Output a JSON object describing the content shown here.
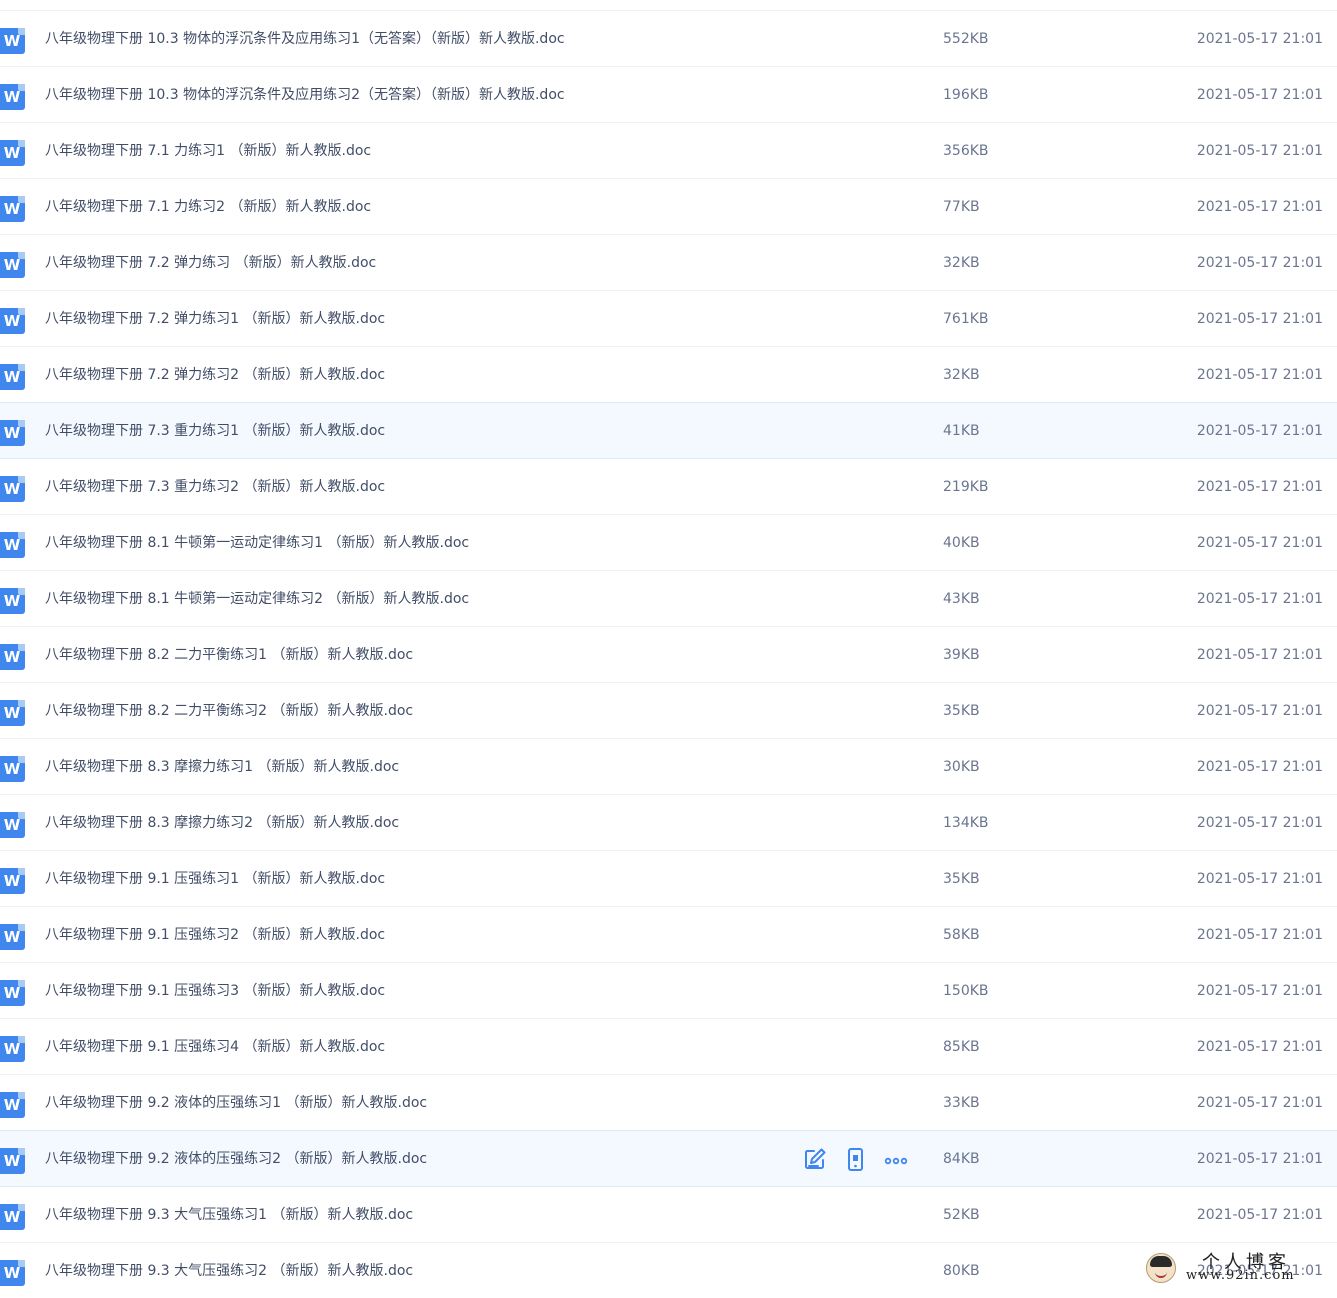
{
  "files": [
    {
      "name": "八年级物理下册 10.3 物体的浮沉条件及应用练习1（无答案）（新版）新人教版.doc",
      "size": "552KB",
      "date": "2021-05-17 21:01"
    },
    {
      "name": "八年级物理下册 10.3 物体的浮沉条件及应用练习2（无答案）（新版）新人教版.doc",
      "size": "196KB",
      "date": "2021-05-17 21:01"
    },
    {
      "name": "八年级物理下册 7.1 力练习1 （新版）新人教版.doc",
      "size": "356KB",
      "date": "2021-05-17 21:01"
    },
    {
      "name": "八年级物理下册 7.1 力练习2 （新版）新人教版.doc",
      "size": "77KB",
      "date": "2021-05-17 21:01"
    },
    {
      "name": "八年级物理下册 7.2 弹力练习 （新版）新人教版.doc",
      "size": "32KB",
      "date": "2021-05-17 21:01"
    },
    {
      "name": "八年级物理下册 7.2 弹力练习1 （新版）新人教版.doc",
      "size": "761KB",
      "date": "2021-05-17 21:01"
    },
    {
      "name": "八年级物理下册 7.2 弹力练习2 （新版）新人教版.doc",
      "size": "32KB",
      "date": "2021-05-17 21:01"
    },
    {
      "name": "八年级物理下册 7.3 重力练习1 （新版）新人教版.doc",
      "size": "41KB",
      "date": "2021-05-17 21:01",
      "hover": true
    },
    {
      "name": "八年级物理下册 7.3 重力练习2 （新版）新人教版.doc",
      "size": "219KB",
      "date": "2021-05-17 21:01"
    },
    {
      "name": "八年级物理下册 8.1 牛顿第一运动定律练习1 （新版）新人教版.doc",
      "size": "40KB",
      "date": "2021-05-17 21:01"
    },
    {
      "name": "八年级物理下册 8.1 牛顿第一运动定律练习2 （新版）新人教版.doc",
      "size": "43KB",
      "date": "2021-05-17 21:01"
    },
    {
      "name": "八年级物理下册 8.2 二力平衡练习1 （新版）新人教版.doc",
      "size": "39KB",
      "date": "2021-05-17 21:01"
    },
    {
      "name": "八年级物理下册 8.2 二力平衡练习2 （新版）新人教版.doc",
      "size": "35KB",
      "date": "2021-05-17 21:01"
    },
    {
      "name": "八年级物理下册 8.3 摩擦力练习1 （新版）新人教版.doc",
      "size": "30KB",
      "date": "2021-05-17 21:01"
    },
    {
      "name": "八年级物理下册 8.3 摩擦力练习2 （新版）新人教版.doc",
      "size": "134KB",
      "date": "2021-05-17 21:01"
    },
    {
      "name": "八年级物理下册 9.1 压强练习1 （新版）新人教版.doc",
      "size": "35KB",
      "date": "2021-05-17 21:01"
    },
    {
      "name": "八年级物理下册 9.1 压强练习2 （新版）新人教版.doc",
      "size": "58KB",
      "date": "2021-05-17 21:01"
    },
    {
      "name": "八年级物理下册 9.1 压强练习3 （新版）新人教版.doc",
      "size": "150KB",
      "date": "2021-05-17 21:01"
    },
    {
      "name": "八年级物理下册 9.1 压强练习4 （新版）新人教版.doc",
      "size": "85KB",
      "date": "2021-05-17 21:01"
    },
    {
      "name": "八年级物理下册 9.2 液体的压强练习1 （新版）新人教版.doc",
      "size": "33KB",
      "date": "2021-05-17 21:01"
    },
    {
      "name": "八年级物理下册 9.2 液体的压强练习2 （新版）新人教版.doc",
      "size": "84KB",
      "date": "2021-05-17 21:01",
      "hover": true,
      "actions": true
    },
    {
      "name": "八年级物理下册 9.3 大气压强练习1 （新版）新人教版.doc",
      "size": "52KB",
      "date": "2021-05-17 21:01"
    },
    {
      "name": "八年级物理下册 9.3 大气压强练习2 （新版）新人教版.doc",
      "size": "80KB",
      "date": "2021-05-17 21:01"
    }
  ],
  "file_icon_letter": "W",
  "icons": {
    "file": "word-doc-icon",
    "edit": "edit-icon",
    "mobile": "phone-icon",
    "more": "more-icon"
  },
  "colors": {
    "accent": "#3f86ef",
    "hover_row": "#f4f9ff",
    "text": "#424e67",
    "meta_text": "#6a7590"
  },
  "watermark": {
    "title": "个人博客",
    "url": "www.92in.com"
  }
}
